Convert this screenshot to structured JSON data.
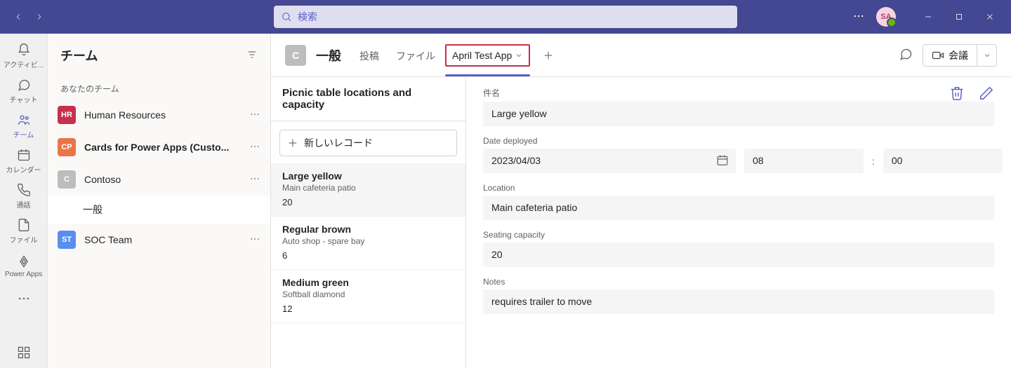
{
  "colors": {
    "accent": "#5b5fc7",
    "titlebar": "#444791",
    "searchbg": "#dedef0",
    "highlight": "#c4314b"
  },
  "titlebar": {
    "search_placeholder": "検索",
    "avatar_initials": "SA"
  },
  "rail": {
    "items": [
      {
        "label": "アクティビ..."
      },
      {
        "label": "チャット"
      },
      {
        "label": "チーム"
      },
      {
        "label": "カレンダー"
      },
      {
        "label": "通話"
      },
      {
        "label": "ファイル"
      },
      {
        "label": "Power Apps"
      }
    ]
  },
  "teams_panel": {
    "title": "チーム",
    "section_label": "あなたのチーム",
    "teams": [
      {
        "badge": "HR",
        "name": "Human Resources"
      },
      {
        "badge": "CP",
        "name": "Cards for Power Apps (Custo..."
      },
      {
        "badge": "C",
        "name": "Contoso"
      },
      {
        "badge": "ST",
        "name": "SOC Team"
      }
    ],
    "channel_general": "一般"
  },
  "channel_header": {
    "badge": "C",
    "title": "一般",
    "tabs": [
      {
        "label": "投稿"
      },
      {
        "label": "ファイル"
      },
      {
        "label": "April Test App"
      }
    ],
    "meet_label": "会議"
  },
  "app": {
    "list_title": "Picnic table locations and capacity",
    "new_record_label": "新しいレコード",
    "records": [
      {
        "title": "Large yellow",
        "sub": "Main cafeteria patio",
        "num": "20"
      },
      {
        "title": "Regular brown",
        "sub": "Auto shop - spare bay",
        "num": "6"
      },
      {
        "title": "Medium green",
        "sub": "Softball diamond",
        "num": "12"
      }
    ],
    "detail": {
      "labels": {
        "subject": "件名",
        "date_deployed": "Date deployed",
        "location": "Location",
        "seating": "Seating capacity",
        "notes": "Notes"
      },
      "values": {
        "subject": "Large yellow",
        "date": "2023/04/03",
        "hour": "08",
        "minute": "00",
        "location": "Main cafeteria patio",
        "seating": "20",
        "notes": "requires trailer to move"
      },
      "time_separator": ":"
    }
  }
}
